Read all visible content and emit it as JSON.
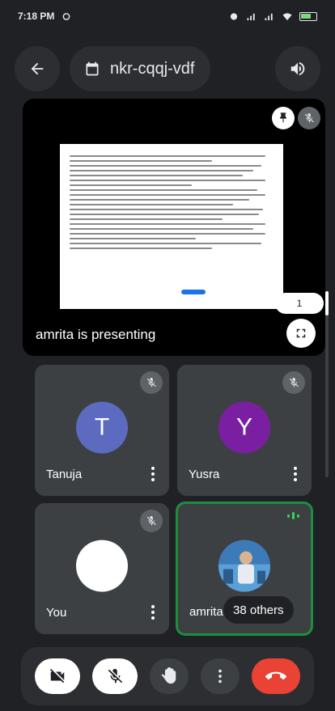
{
  "status_bar": {
    "time": "7:18 PM"
  },
  "top_bar": {
    "meeting_code": "nkr-cqqj-vdf"
  },
  "presentation": {
    "label": "amrita is presenting",
    "page_number": "1"
  },
  "participants": [
    {
      "name": "Tanuja",
      "initial": "T",
      "avatar_color": "#5c6bc0",
      "muted": true
    },
    {
      "name": "Yusra",
      "initial": "Y",
      "avatar_color": "#7b1fa2",
      "muted": true
    },
    {
      "name": "You",
      "initial": "",
      "avatar_color": "#ffffff",
      "muted": true
    },
    {
      "name": "amrita",
      "initial": "",
      "avatar_color": "#4a8ccf",
      "muted": false,
      "speaking": true
    }
  ],
  "others": {
    "label": "38 others"
  },
  "colors": {
    "accent_green": "#1e8e3e",
    "hangup_red": "#ea4335"
  }
}
